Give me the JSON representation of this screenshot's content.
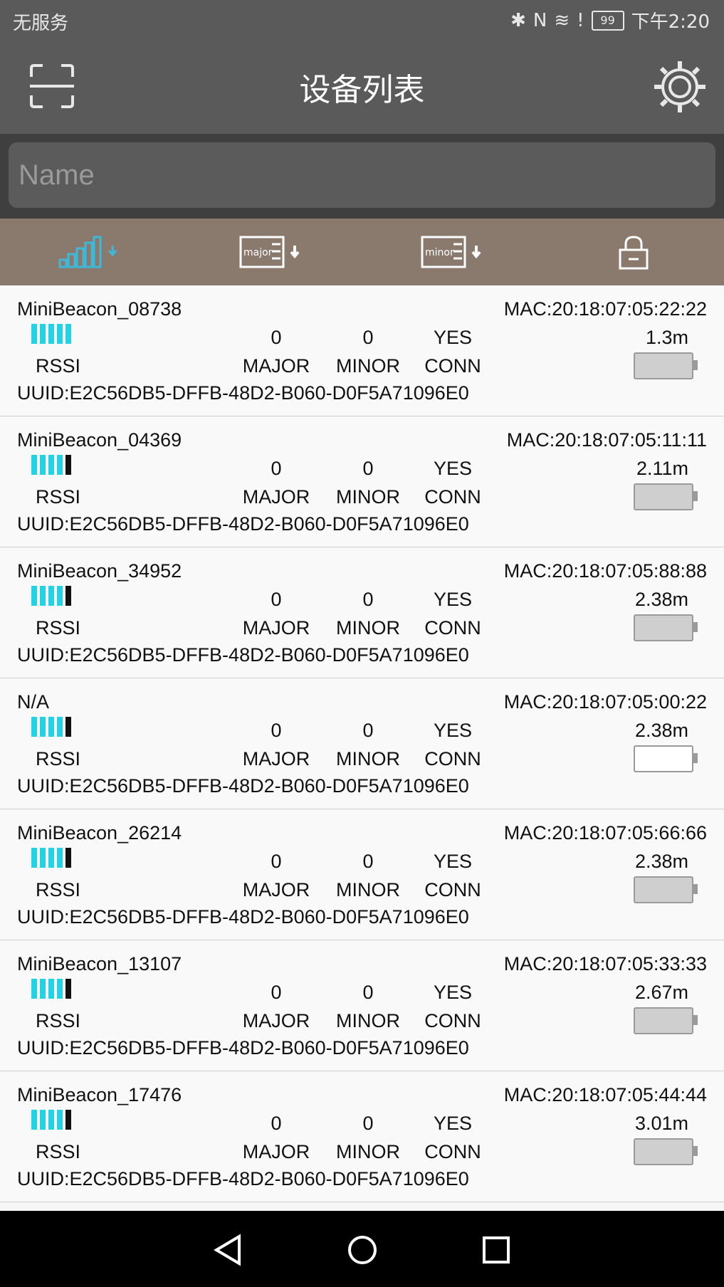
{
  "status_bar": {
    "carrier": "无服务",
    "battery": "99",
    "time": "下午2:20"
  },
  "app_bar": {
    "title": "设备列表"
  },
  "search": {
    "placeholder": "Name"
  },
  "sort": {
    "major_label": "major",
    "minor_label": "minor"
  },
  "labels": {
    "rssi": "RSSI",
    "major": "MAJOR",
    "minor": "MINOR",
    "conn": "CONN"
  },
  "colors": {
    "accent": "#22d3e6",
    "header": "#5a5a5a",
    "sort_bar": "#8a7a6e"
  },
  "devices": [
    {
      "name": "MiniBeacon_08738",
      "mac": "MAC:20:18:07:05:22:22",
      "major": "0",
      "minor": "0",
      "conn": "YES",
      "distance": "1.3m",
      "uuid": "UUID:E2C56DB5-DFFB-48D2-B060-D0F5A71096E0",
      "rssi_level": 5,
      "battery": "full"
    },
    {
      "name": "MiniBeacon_04369",
      "mac": "MAC:20:18:07:05:11:11",
      "major": "0",
      "minor": "0",
      "conn": "YES",
      "distance": "2.11m",
      "uuid": "UUID:E2C56DB5-DFFB-48D2-B060-D0F5A71096E0",
      "rssi_level": 4,
      "battery": "full"
    },
    {
      "name": "MiniBeacon_34952",
      "mac": "MAC:20:18:07:05:88:88",
      "major": "0",
      "minor": "0",
      "conn": "YES",
      "distance": "2.38m",
      "uuid": "UUID:E2C56DB5-DFFB-48D2-B060-D0F5A71096E0",
      "rssi_level": 4,
      "battery": "full"
    },
    {
      "name": "N/A",
      "mac": "MAC:20:18:07:05:00:22",
      "major": "0",
      "minor": "0",
      "conn": "YES",
      "distance": "2.38m",
      "uuid": "UUID:E2C56DB5-DFFB-48D2-B060-D0F5A71096E0",
      "rssi_level": 4,
      "battery": "empty"
    },
    {
      "name": "MiniBeacon_26214",
      "mac": "MAC:20:18:07:05:66:66",
      "major": "0",
      "minor": "0",
      "conn": "YES",
      "distance": "2.38m",
      "uuid": "UUID:E2C56DB5-DFFB-48D2-B060-D0F5A71096E0",
      "rssi_level": 4,
      "battery": "full"
    },
    {
      "name": "MiniBeacon_13107",
      "mac": "MAC:20:18:07:05:33:33",
      "major": "0",
      "minor": "0",
      "conn": "YES",
      "distance": "2.67m",
      "uuid": "UUID:E2C56DB5-DFFB-48D2-B060-D0F5A71096E0",
      "rssi_level": 4,
      "battery": "full"
    },
    {
      "name": "MiniBeacon_17476",
      "mac": "MAC:20:18:07:05:44:44",
      "major": "0",
      "minor": "0",
      "conn": "YES",
      "distance": "3.01m",
      "uuid": "UUID:E2C56DB5-DFFB-48D2-B060-D0F5A71096E0",
      "rssi_level": 4,
      "battery": "full"
    }
  ]
}
